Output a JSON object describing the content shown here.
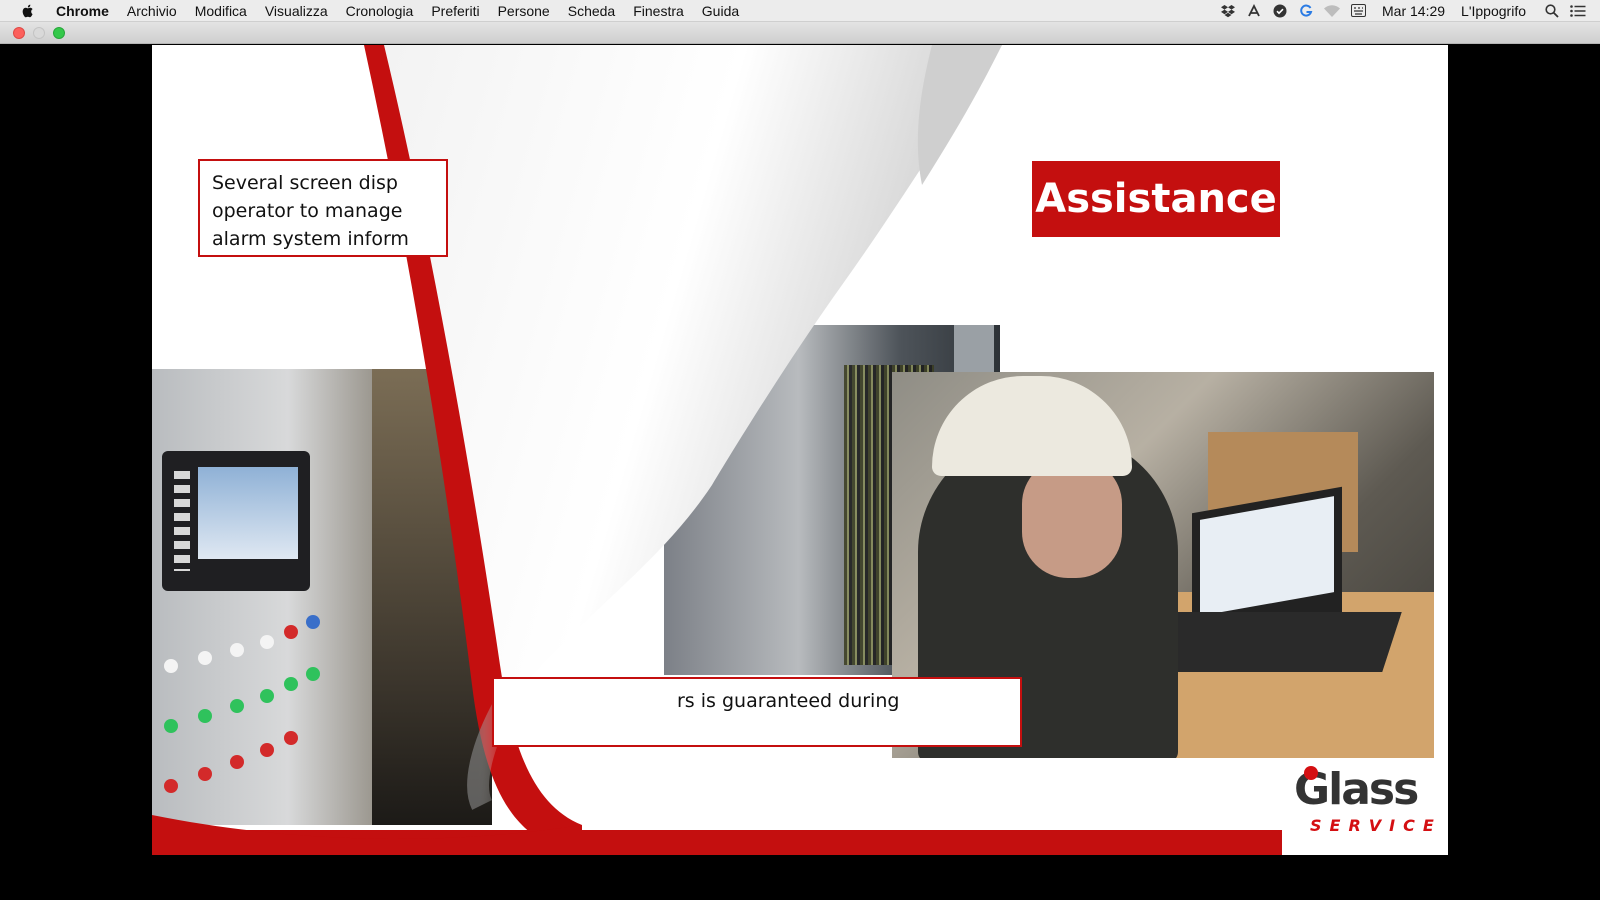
{
  "menubar": {
    "app": "Chrome",
    "menus": [
      "Archivio",
      "Modifica",
      "Visualizza",
      "Cronologia",
      "Preferiti",
      "Persone",
      "Scheda",
      "Finestra",
      "Guida"
    ],
    "clock": "Mar 14:29",
    "user": "L'Ippogrifo"
  },
  "slide": {
    "callout_top": [
      "Several screen disp",
      "operator to manage",
      "alarm system inform"
    ],
    "callout_bottom": "rs is guaranteed during",
    "badge": "Assistance",
    "logo": {
      "word": "Glass",
      "sub": "SERVICE"
    }
  },
  "colors": {
    "accent": "#c40f0f",
    "menubar": "#ececec",
    "background": "#000000"
  }
}
